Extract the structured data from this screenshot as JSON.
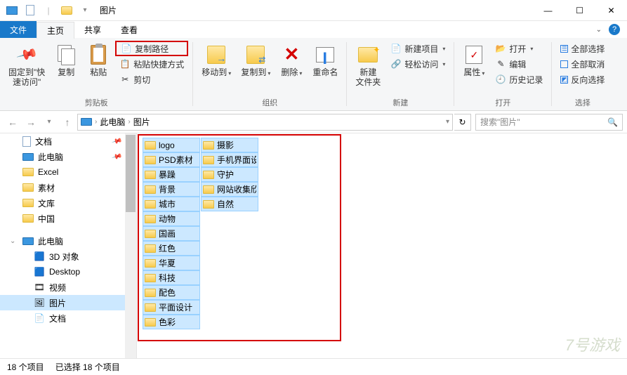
{
  "window": {
    "title": "图片",
    "min": "—",
    "max": "☐",
    "close": "✕"
  },
  "tabs": {
    "file": "文件",
    "home": "主页",
    "share": "共享",
    "view": "查看"
  },
  "ribbon": {
    "pin": "固定到\"快\n速访问\"",
    "copy": "复制",
    "paste": "粘贴",
    "copypath": "复制路径",
    "pasteshortcut": "粘贴快捷方式",
    "cut": "剪切",
    "moveto": "移动到",
    "copyto": "复制到",
    "delete": "删除",
    "rename": "重命名",
    "newfolder": "新建\n文件夹",
    "newitem": "新建项目",
    "easyaccess": "轻松访问",
    "properties": "属性",
    "open": "打开",
    "edit": "编辑",
    "history": "历史记录",
    "selectall": "全部选择",
    "selectnone": "全部取消",
    "invert": "反向选择",
    "g_clipboard": "剪贴板",
    "g_organize": "组织",
    "g_new": "新建",
    "g_open": "打开",
    "g_select": "选择"
  },
  "breadcrumb": {
    "root": "此电脑",
    "current": "图片"
  },
  "search": {
    "placeholder": "搜索\"图片\""
  },
  "nav": {
    "items": [
      {
        "label": "文档",
        "type": "doc",
        "pin": true
      },
      {
        "label": "此电脑",
        "type": "pc",
        "pin": true
      },
      {
        "label": "Excel",
        "type": "folder"
      },
      {
        "label": "素材",
        "type": "folder"
      },
      {
        "label": "文库",
        "type": "folder"
      },
      {
        "label": "中国",
        "type": "folder"
      }
    ],
    "thispc": "此电脑",
    "children": [
      {
        "label": "3D 对象",
        "type": "3d"
      },
      {
        "label": "Desktop",
        "type": "desktop"
      },
      {
        "label": "视频",
        "type": "video"
      },
      {
        "label": "图片",
        "type": "pictures",
        "selected": true
      },
      {
        "label": "文档",
        "type": "doc"
      }
    ]
  },
  "files": [
    "logo",
    "PSD素材",
    "暴躁",
    "背景",
    "城市",
    "动物",
    "国画",
    "红色",
    "华夏",
    "科技",
    "配色",
    "平面设计",
    "色彩",
    "摄影",
    "手机界面设计",
    "守护",
    "网站收集欣赏",
    "自然"
  ],
  "status": {
    "count": "18 个项目",
    "selected": "已选择 18 个项目"
  },
  "watermark": "7号游戏"
}
